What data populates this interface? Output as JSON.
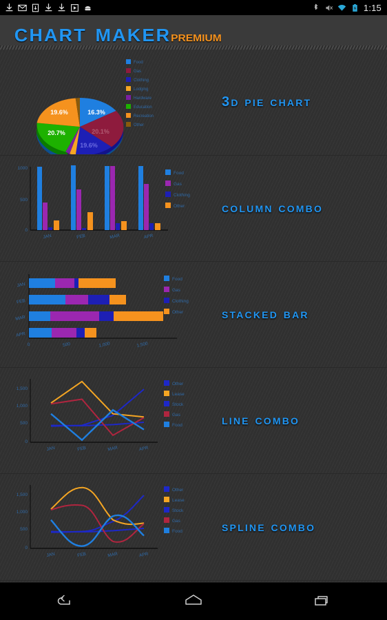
{
  "statusbar": {
    "time": "1:15",
    "left_icons": [
      "download-icon",
      "gmail-icon",
      "sim-card-icon",
      "download-icon",
      "download-icon",
      "play-store-icon",
      "android-icon"
    ],
    "right_icons": [
      "bluetooth-icon",
      "mute-icon",
      "wifi-icon",
      "battery-charging-icon"
    ]
  },
  "header": {
    "title_main": "Chart Maker",
    "title_sub": "premium",
    "color_main": "#2196f3",
    "color_sub": "#f5921e"
  },
  "colors": {
    "food": "#1f7fe0",
    "gas": "#8e1b3d",
    "gas_alt": "#9b27b0",
    "gas_line": "#b0253f",
    "clothing": "#1d1fb5",
    "lodging": "#f5a623",
    "hardware": "#7b1fa2",
    "education": "#1db100",
    "recreation": "#f5921e",
    "other": "#8a5a0b",
    "other_blue": "#1d1fb5",
    "lease": "#f5a623",
    "stock": "#1d28c8",
    "axis": "#000000",
    "tick_text": "#4a7fc1",
    "accent": "#2196f3"
  },
  "rows": [
    {
      "title": "3D Pie Chart",
      "chart_key": "pie"
    },
    {
      "title": "Column Combo",
      "chart_key": "column"
    },
    {
      "title": "Stacked Bar",
      "chart_key": "stacked"
    },
    {
      "title": "Line Combo",
      "chart_key": "line"
    },
    {
      "title": "Spline Combo",
      "chart_key": "spline"
    }
  ],
  "chart_data": [
    {
      "type": "pie",
      "title": "3D Pie Chart",
      "legend_position": "right",
      "categories": [
        "Food",
        "Gas",
        "Clothing",
        "Lodging",
        "Hardware",
        "Education",
        "Recreation",
        "Other"
      ],
      "values": [
        16.3,
        20.1,
        19.6,
        2.1,
        1.3,
        20.7,
        19.6,
        0.3
      ],
      "labels": [
        "16.3%",
        "20.1%",
        "19.6%",
        "",
        "",
        "20.7%",
        "19.6%",
        ""
      ],
      "colors": [
        "#1f7fe0",
        "#8e1b3d",
        "#1d1fb5",
        "#f5a623",
        "#7b1fa2",
        "#1db100",
        "#f5921e",
        "#8a5a0b"
      ]
    },
    {
      "type": "bar",
      "title": "Column Combo",
      "categories": [
        "JAN",
        "FEB",
        "MAR",
        "APR"
      ],
      "ylim": [
        0,
        1100
      ],
      "yticks": [
        0,
        500,
        1000
      ],
      "ytick_labels": [
        "0",
        "500",
        "1000"
      ],
      "legend_position": "right",
      "series": [
        {
          "name": "Food",
          "color": "#1f7fe0",
          "values": [
            1000,
            1050,
            1030,
            1020
          ]
        },
        {
          "name": "Gas",
          "color": "#9b27b0",
          "values": [
            430,
            650,
            1040,
            760
          ]
        },
        {
          "name": "Clothing",
          "color": "#1d1fb5",
          "values": [
            40,
            35,
            110,
            115
          ]
        },
        {
          "name": "Other",
          "color": "#f5921e",
          "values": [
            150,
            280,
            140,
            110
          ]
        }
      ]
    },
    {
      "type": "bar",
      "orientation": "horizontal",
      "stacked": true,
      "title": "Stacked Bar",
      "categories": [
        "JAN",
        "FEB",
        "MAR",
        "APR"
      ],
      "xlim": [
        0,
        1600
      ],
      "xticks": [
        0,
        500,
        1000,
        1500
      ],
      "xtick_labels": [
        "0",
        "500",
        "1,000",
        "1,500"
      ],
      "legend_position": "right",
      "series": [
        {
          "name": "Food",
          "color": "#1f7fe0",
          "values": [
            300,
            420,
            240,
            260
          ]
        },
        {
          "name": "Gas",
          "color": "#9b27b0",
          "values": [
            220,
            260,
            560,
            280
          ]
        },
        {
          "name": "Clothing",
          "color": "#1d1fb5",
          "values": [
            40,
            240,
            160,
            90
          ]
        },
        {
          "name": "Other",
          "color": "#f5921e",
          "values": [
            420,
            190,
            560,
            130
          ]
        }
      ]
    },
    {
      "type": "line",
      "title": "Line Combo",
      "categories": [
        "JAN",
        "FEB",
        "MAR",
        "APR"
      ],
      "ylim": [
        0,
        1650
      ],
      "yticks": [
        0,
        500,
        1000,
        1500
      ],
      "ytick_labels": [
        "0",
        "500",
        "1,000",
        "1,500"
      ],
      "legend_position": "right",
      "series": [
        {
          "name": "Other",
          "color": "#1d28c8",
          "values": [
            420,
            440,
            700,
            1380
          ]
        },
        {
          "name": "Lease",
          "color": "#f5a623",
          "values": [
            1020,
            1600,
            740,
            660
          ]
        },
        {
          "name": "Stock",
          "color": "#1d28c8",
          "values": [
            440,
            430,
            460,
            520
          ]
        },
        {
          "name": "Gas",
          "color": "#b0253f",
          "values": [
            1000,
            1120,
            180,
            640
          ]
        },
        {
          "name": "Food",
          "color": "#1f7fe0",
          "values": [
            740,
            60,
            840,
            330
          ]
        }
      ]
    },
    {
      "type": "line",
      "smooth": true,
      "title": "Spline Combo",
      "categories": [
        "JAN",
        "FEB",
        "MAR",
        "APR"
      ],
      "ylim": [
        0,
        1650
      ],
      "yticks": [
        0,
        500,
        1000,
        1500
      ],
      "ytick_labels": [
        "0",
        "500",
        "1,000",
        "1,500"
      ],
      "legend_position": "right",
      "series": [
        {
          "name": "Other",
          "color": "#1d28c8",
          "values": [
            420,
            440,
            700,
            1380
          ]
        },
        {
          "name": "Lease",
          "color": "#f5a623",
          "values": [
            1020,
            1600,
            740,
            660
          ]
        },
        {
          "name": "Stock",
          "color": "#1d28c8",
          "values": [
            440,
            430,
            460,
            520
          ]
        },
        {
          "name": "Gas",
          "color": "#b0253f",
          "values": [
            1000,
            1120,
            180,
            640
          ]
        },
        {
          "name": "Food",
          "color": "#1f7fe0",
          "values": [
            740,
            60,
            840,
            330
          ]
        }
      ]
    }
  ],
  "navbar": {
    "buttons": [
      {
        "name": "back-button",
        "icon": "back-icon"
      },
      {
        "name": "home-button",
        "icon": "home-icon"
      },
      {
        "name": "recents-button",
        "icon": "recents-icon"
      }
    ]
  }
}
